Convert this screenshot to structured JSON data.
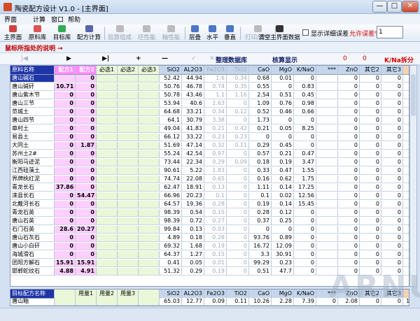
{
  "window": {
    "title": "陶瓷配方设计 V1.0 - [主界面]",
    "min": "—",
    "max": "□",
    "close": "✕"
  },
  "menu": [
    "界面",
    "计算",
    "窗口",
    "帮助"
  ],
  "toolbar": {
    "items": [
      {
        "label": "主界面",
        "icon": "home-icon",
        "disabled": false
      },
      {
        "label": "原料库",
        "icon": "database-icon",
        "disabled": false
      },
      {
        "label": "目标库",
        "icon": "target-icon",
        "disabled": false
      },
      {
        "label": "配方计算",
        "icon": "calculator-icon",
        "disabled": false
      },
      {
        "label": "验算组成",
        "icon": "check-icon",
        "disabled": true
      },
      {
        "label": "坯性能",
        "icon": "body-icon",
        "disabled": true
      },
      {
        "label": "釉性能",
        "icon": "glaze-icon",
        "disabled": true
      },
      {
        "label": "层叠",
        "icon": "cascade-icon",
        "disabled": false
      },
      {
        "label": "水平",
        "icon": "tile-horizontal-icon",
        "disabled": false
      },
      {
        "label": "垂直",
        "icon": "tile-vertical-icon",
        "disabled": false
      },
      {
        "label": "打印/预览",
        "icon": "printer-icon",
        "disabled": true
      },
      {
        "label": "清空主界面数据",
        "icon": "clear-icon",
        "disabled": false
      }
    ],
    "show_error": "显示详细误差",
    "allow_error_label": "允许误差%",
    "allow_error_value": "1"
  },
  "info": "鼠标所指处的说明 →",
  "nav": {
    "items": [
      "|◀",
      "▶",
      "▶|",
      "+",
      "—",
      "✓",
      "✕"
    ],
    "title": "整理数据库",
    "calc": "核算显示",
    "zero_value": "0",
    "zero_value2": "0",
    "mode": "K/Na拆分"
  },
  "grid": {
    "headers": [
      "原料名称",
      "配方1",
      "配方2",
      "必选1",
      "必选2",
      "必选3",
      "SiO2",
      "AL2O3",
      "Fe2O3",
      "TiO2",
      "CaO",
      "MgO",
      "K/NaO",
      "***",
      "ZnO",
      "其它2",
      "其它3",
      "单价"
    ],
    "rows": [
      {
        "name": "唐山碱石",
        "p1": "",
        "p2": "0",
        "sio2": "52.42",
        "al2o3": "44.94",
        "fe2o3": "1.6",
        "tio2": "0.34",
        "cao": "0.68",
        "mgo": "0.01",
        "kna": "0",
        "star": "",
        "zno": "0",
        "o2": "0",
        "o3": "0",
        "price": "1",
        "selected": true
      },
      {
        "name": "唐山碱矸",
        "p1": "10.71",
        "p2": "0",
        "sio2": "50.76",
        "al2o3": "46.78",
        "fe2o3": "0.74",
        "tio2": "0.35",
        "cao": "0.55",
        "mgo": "0",
        "kna": "0.83",
        "star": "",
        "zno": "0",
        "o2": "0",
        "o3": "0",
        "price": "1"
      },
      {
        "name": "唐山紫木节",
        "p1": "0",
        "p2": "0",
        "sio2": "50.78",
        "al2o3": "43.46",
        "fe2o3": "1.1",
        "tio2": "1.16",
        "cao": "2.54",
        "mgo": "0.51",
        "kna": "0.45",
        "star": "",
        "zno": "0",
        "o2": "0",
        "o3": "0",
        "price": "1"
      },
      {
        "name": "唐山三节",
        "p1": "0",
        "p2": "0",
        "sio2": "53.94",
        "al2o3": "40.6",
        "fe2o3": "2.63",
        "tio2": "0",
        "cao": "1.09",
        "mgo": "0.76",
        "kna": "0.98",
        "star": "",
        "zno": "0",
        "o2": "0",
        "o3": "0",
        "price": "1"
      },
      {
        "name": "苋城土",
        "p1": "0",
        "p2": "0",
        "sio2": "64.68",
        "al2o3": "33.21",
        "fe2o3": "0.34",
        "tio2": "0.12",
        "cao": "0.52",
        "mgo": "0.46",
        "kna": "0.66",
        "star": "",
        "zno": "0",
        "o2": "0",
        "o3": "0",
        "price": "1"
      },
      {
        "name": "唐山四节",
        "p1": "0",
        "p2": "0",
        "sio2": "64.1",
        "al2o3": "30.79",
        "fe2o3": "3.38",
        "tio2": "0",
        "cao": "1.73",
        "mgo": "0",
        "kna": "0",
        "star": "",
        "zno": "0",
        "o2": "0",
        "o3": "0",
        "price": "1"
      },
      {
        "name": "章村土",
        "p1": "0",
        "p2": "0",
        "sio2": "49.04",
        "al2o3": "41.83",
        "fe2o3": "0.21",
        "tio2": "0.42",
        "cao": "0.21",
        "mgo": "0.05",
        "kna": "8.25",
        "star": "",
        "zno": "0",
        "o2": "0",
        "o3": "0",
        "price": "1"
      },
      {
        "name": "易县土",
        "p1": "0",
        "p2": "0",
        "sio2": "66.12",
        "al2o3": "33.22",
        "fe2o3": "0.23",
        "tio2": "0.23",
        "cao": "0",
        "mgo": "0",
        "kna": "0",
        "star": "",
        "zno": "0",
        "o2": "0",
        "o3": "0",
        "price": "1"
      },
      {
        "name": "大同土",
        "p1": "0",
        "p2": "1.87",
        "sio2": "51.69",
        "al2o3": "47.14",
        "fe2o3": "0.32",
        "tio2": "0.11",
        "cao": "0.29",
        "mgo": "0.45",
        "kna": "0",
        "star": "",
        "zno": "0",
        "o2": "0",
        "o3": "0",
        "price": "1"
      },
      {
        "name": "苏州土2#",
        "p1": "0",
        "p2": "0",
        "sio2": "55.24",
        "al2o3": "42.54",
        "fe2o3": "0.97",
        "tio2": "0",
        "cao": "0.57",
        "mgo": "0.21",
        "kna": "0.47",
        "star": "",
        "zno": "0",
        "o2": "0",
        "o3": "0",
        "price": "1"
      },
      {
        "name": "衡阳马迹泥",
        "p1": "0",
        "p2": "0",
        "sio2": "73.44",
        "al2o3": "22.34",
        "fe2o3": "0.29",
        "tio2": "0.09",
        "cao": "0.18",
        "mgo": "0.19",
        "kna": "3.47",
        "star": "",
        "zno": "0",
        "o2": "0",
        "o3": "0",
        "price": "1"
      },
      {
        "name": "江西硅藻土",
        "p1": "0",
        "p2": "0",
        "sio2": "90.61",
        "al2o3": "5.22",
        "fe2o3": "1.83",
        "tio2": "0",
        "cao": "0.33",
        "mgo": "0.47",
        "kna": "1.55",
        "star": "",
        "zno": "0",
        "o2": "0",
        "o3": "0",
        "price": "1"
      },
      {
        "name": "界牌桃红泥",
        "p1": "0",
        "p2": "0",
        "sio2": "74.74",
        "al2o3": "22.08",
        "fe2o3": "0.65",
        "tio2": "0",
        "cao": "0.16",
        "mgo": "0.62",
        "kna": "1.75",
        "star": "",
        "zno": "0",
        "o2": "0",
        "o3": "0",
        "price": "1"
      },
      {
        "name": "青龙长石",
        "p1": "37.86",
        "p2": "0",
        "sio2": "62.47",
        "al2o3": "18.91",
        "fe2o3": "0.13",
        "tio2": "0",
        "cao": "1.11",
        "mgo": "0.14",
        "kna": "17.25",
        "star": "",
        "zno": "0",
        "o2": "0",
        "o3": "0",
        "price": "1"
      },
      {
        "name": "滦县长石",
        "p1": "0",
        "p2": "54.47",
        "sio2": "66.96",
        "al2o3": "20.23",
        "fe2o3": "0.1",
        "tio2": "0",
        "cao": "0.1",
        "mgo": "0.02",
        "kna": "12.56",
        "star": "",
        "zno": "0",
        "o2": "0",
        "o3": "0",
        "price": "1"
      },
      {
        "name": "北戴河长石",
        "p1": "0",
        "p2": "0",
        "sio2": "64.57",
        "al2o3": "19.36",
        "fe2o3": "0.28",
        "tio2": "0",
        "cao": "0.19",
        "mgo": "0.14",
        "kna": "15.45",
        "star": "",
        "zno": "0",
        "o2": "0",
        "o3": "0",
        "price": "1"
      },
      {
        "name": "青龙石英",
        "p1": "0",
        "p2": "0",
        "sio2": "98.39",
        "al2o3": "0.54",
        "fe2o3": "0.15",
        "tio2": "0",
        "cao": "0.28",
        "mgo": "0.12",
        "kna": "0",
        "star": "",
        "zno": "0",
        "o2": "0",
        "o3": "0",
        "price": "1"
      },
      {
        "name": "唐山石英",
        "p1": "0",
        "p2": "0",
        "sio2": "98.39",
        "al2o3": "0.72",
        "fe2o3": "0.27",
        "tio2": "0",
        "cao": "0.37",
        "mgo": "0.25",
        "kna": "0",
        "star": "",
        "zno": "0",
        "o2": "0",
        "o3": "0",
        "price": "1"
      },
      {
        "name": "石门石英",
        "p1": "28.6",
        "p2": "20.27",
        "sio2": "99.84",
        "al2o3": "0.13",
        "fe2o3": "0.03",
        "tio2": "0",
        "cao": "0",
        "mgo": "0",
        "kna": "0",
        "star": "",
        "zno": "0",
        "o2": "0",
        "o3": "0",
        "price": "1"
      },
      {
        "name": "唐山石灰石",
        "p1": "0",
        "p2": "0",
        "sio2": "4.89",
        "al2o3": "0.18",
        "fe2o3": "0.28",
        "tio2": "0",
        "cao": "93.76",
        "mgo": "0.89",
        "kna": "0",
        "star": "",
        "zno": "0",
        "o2": "0",
        "o3": "0",
        "price": "1"
      },
      {
        "name": "唐山小白矸",
        "p1": "0",
        "p2": "0",
        "sio2": "69.32",
        "al2o3": "1.68",
        "fe2o3": "0.19",
        "tio2": "0",
        "cao": "16.72",
        "mgo": "12.09",
        "kna": "0",
        "star": "",
        "zno": "0",
        "o2": "0",
        "o3": "0",
        "price": "1"
      },
      {
        "name": "海城滑石",
        "p1": "0",
        "p2": "0",
        "sio2": "64.37",
        "al2o3": "1.27",
        "fe2o3": "0.15",
        "tio2": "0",
        "cao": "3.3",
        "mgo": "30.91",
        "kna": "0",
        "star": "",
        "zno": "0",
        "o2": "0",
        "o3": "0",
        "price": "1"
      },
      {
        "name": "团阳方解石",
        "p1": "15.91",
        "p2": "15.91",
        "sio2": "0.41",
        "al2o3": "0.05",
        "fe2o3": "0.01",
        "tio2": "0",
        "cao": "99.29",
        "mgo": "0.23",
        "kna": "0",
        "star": "",
        "zno": "0",
        "o2": "0",
        "o3": "0",
        "price": "1"
      },
      {
        "name": "邯郸蛇纹石",
        "p1": "4.88",
        "p2": "4.91",
        "sio2": "51.32",
        "al2o3": "0.29",
        "fe2o3": "0.19",
        "tio2": "0",
        "cao": "0.51",
        "mgo": "47.7",
        "kna": "0",
        "star": "",
        "zno": "0",
        "o2": "0",
        "o3": "0",
        "price": "1"
      }
    ]
  },
  "bottom": {
    "headers": [
      "目标配方名称",
      "",
      "用量1",
      "用量2",
      "用量3",
      "SiO2",
      "AL2O3",
      "Fe2O3",
      "TiO2",
      "CaO",
      "MgO",
      "K/NaO",
      "***",
      "ZnO",
      "其它2",
      "其它3",
      "合计"
    ],
    "row": {
      "name": "唐山釉",
      "c1": "",
      "u1": "",
      "u2": "",
      "u3": "",
      "sio2": "65.03",
      "al2o3": "12.77",
      "fe2o3": "0.09",
      "tio2": "0.11",
      "cao": "10.26",
      "mgo": "2.28",
      "kna": "7.39",
      "star": "0",
      "zno": "2.08",
      "o2": "0",
      "o3": "0",
      "total": "100.0"
    }
  },
  "watermark": "ARNUM"
}
